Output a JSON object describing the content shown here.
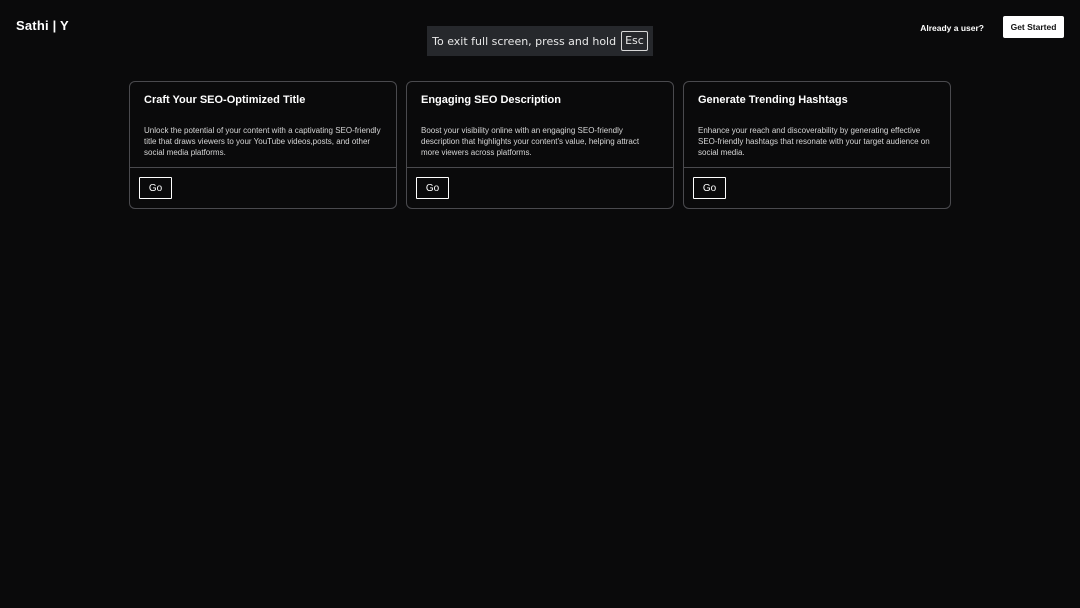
{
  "header": {
    "logo": "Sathi | Y",
    "already_user_link": "Already a user?",
    "get_started_button": "Get Started"
  },
  "fullscreen_banner": {
    "message": "To exit full screen, press and hold",
    "key": "Esc"
  },
  "cards": [
    {
      "title": "Craft Your SEO-Optimized Title",
      "description": "Unlock the potential of your content with a captivating SEO-friendly title that draws viewers to your YouTube videos,posts, and other social media platforms.",
      "button": "Go"
    },
    {
      "title": "Engaging SEO Description",
      "description": "Boost your visibility online with an engaging SEO-friendly description that highlights your content's value, helping attract more viewers across platforms.",
      "button": "Go"
    },
    {
      "title": "Generate Trending Hashtags",
      "description": "Enhance your reach and discoverability by generating effective SEO-friendly hashtags that resonate with your target audience on social media.",
      "button": "Go"
    }
  ]
}
